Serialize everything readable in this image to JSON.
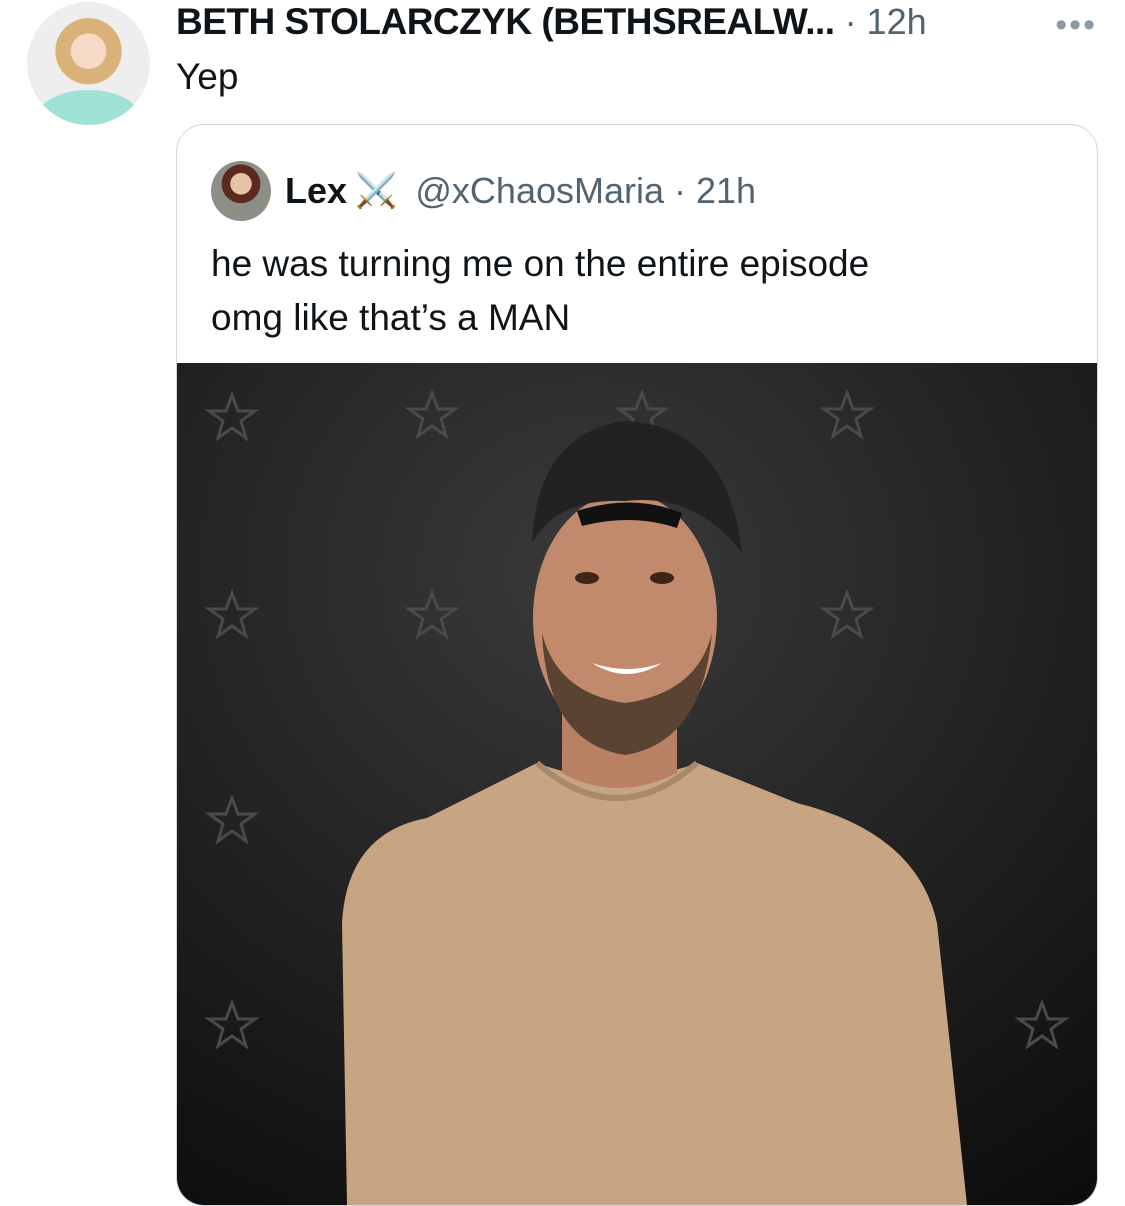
{
  "tweet": {
    "author": "BETH STOLARCZYK (BETHSREALW...",
    "time": "· 12h",
    "more_icon": "more-icon",
    "text": "Yep"
  },
  "quote": {
    "name": "Lex",
    "emoji": "⚔️",
    "handle": "@xChaosMaria · 21h",
    "text_lines": [
      "he was turning me on the entire episode",
      "omg like that’s a MAN"
    ]
  },
  "colors": {
    "text": "#0f1419",
    "secondary": "#536471",
    "border": "#cfd9de",
    "photo_bg": "#151515"
  }
}
